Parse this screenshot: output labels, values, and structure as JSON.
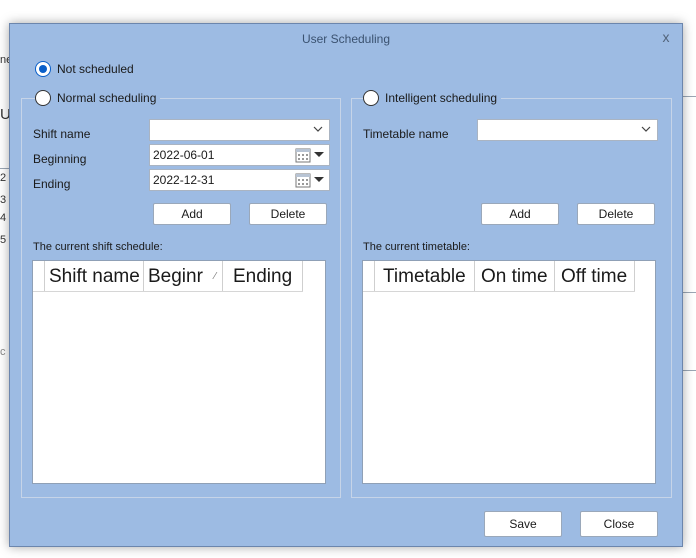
{
  "background": {
    "frag_a": "ne",
    "frag_b": "Us",
    "rows": [
      "2",
      "3",
      "4",
      "5"
    ],
    "frag_c": "c"
  },
  "dialog": {
    "title": "User Scheduling",
    "close_label": "x",
    "not_scheduled_label": "Not scheduled",
    "normal_scheduling_label": "Normal scheduling",
    "intelligent_scheduling_label": "Intelligent scheduling",
    "normal": {
      "shift_name_label": "Shift name",
      "shift_name_value": "",
      "beginning_label": "Beginning",
      "beginning_value": "2022-06-01",
      "ending_label": "Ending",
      "ending_value": "2022-12-31",
      "add_label": "Add",
      "delete_label": "Delete",
      "current_label": "The current shift schedule:",
      "columns": [
        "Shift name",
        "Beginr",
        "Ending"
      ]
    },
    "intelligent": {
      "timetable_name_label": "Timetable name",
      "timetable_name_value": "",
      "add_label": "Add",
      "delete_label": "Delete",
      "current_label": "The current timetable:",
      "columns": [
        "Timetable",
        "On time",
        "Off time"
      ]
    },
    "save_label": "Save",
    "close_button_label": "Close"
  },
  "colors": {
    "dialog_bg": "#9dbbe3",
    "radio_accent": "#0a5fc9"
  }
}
